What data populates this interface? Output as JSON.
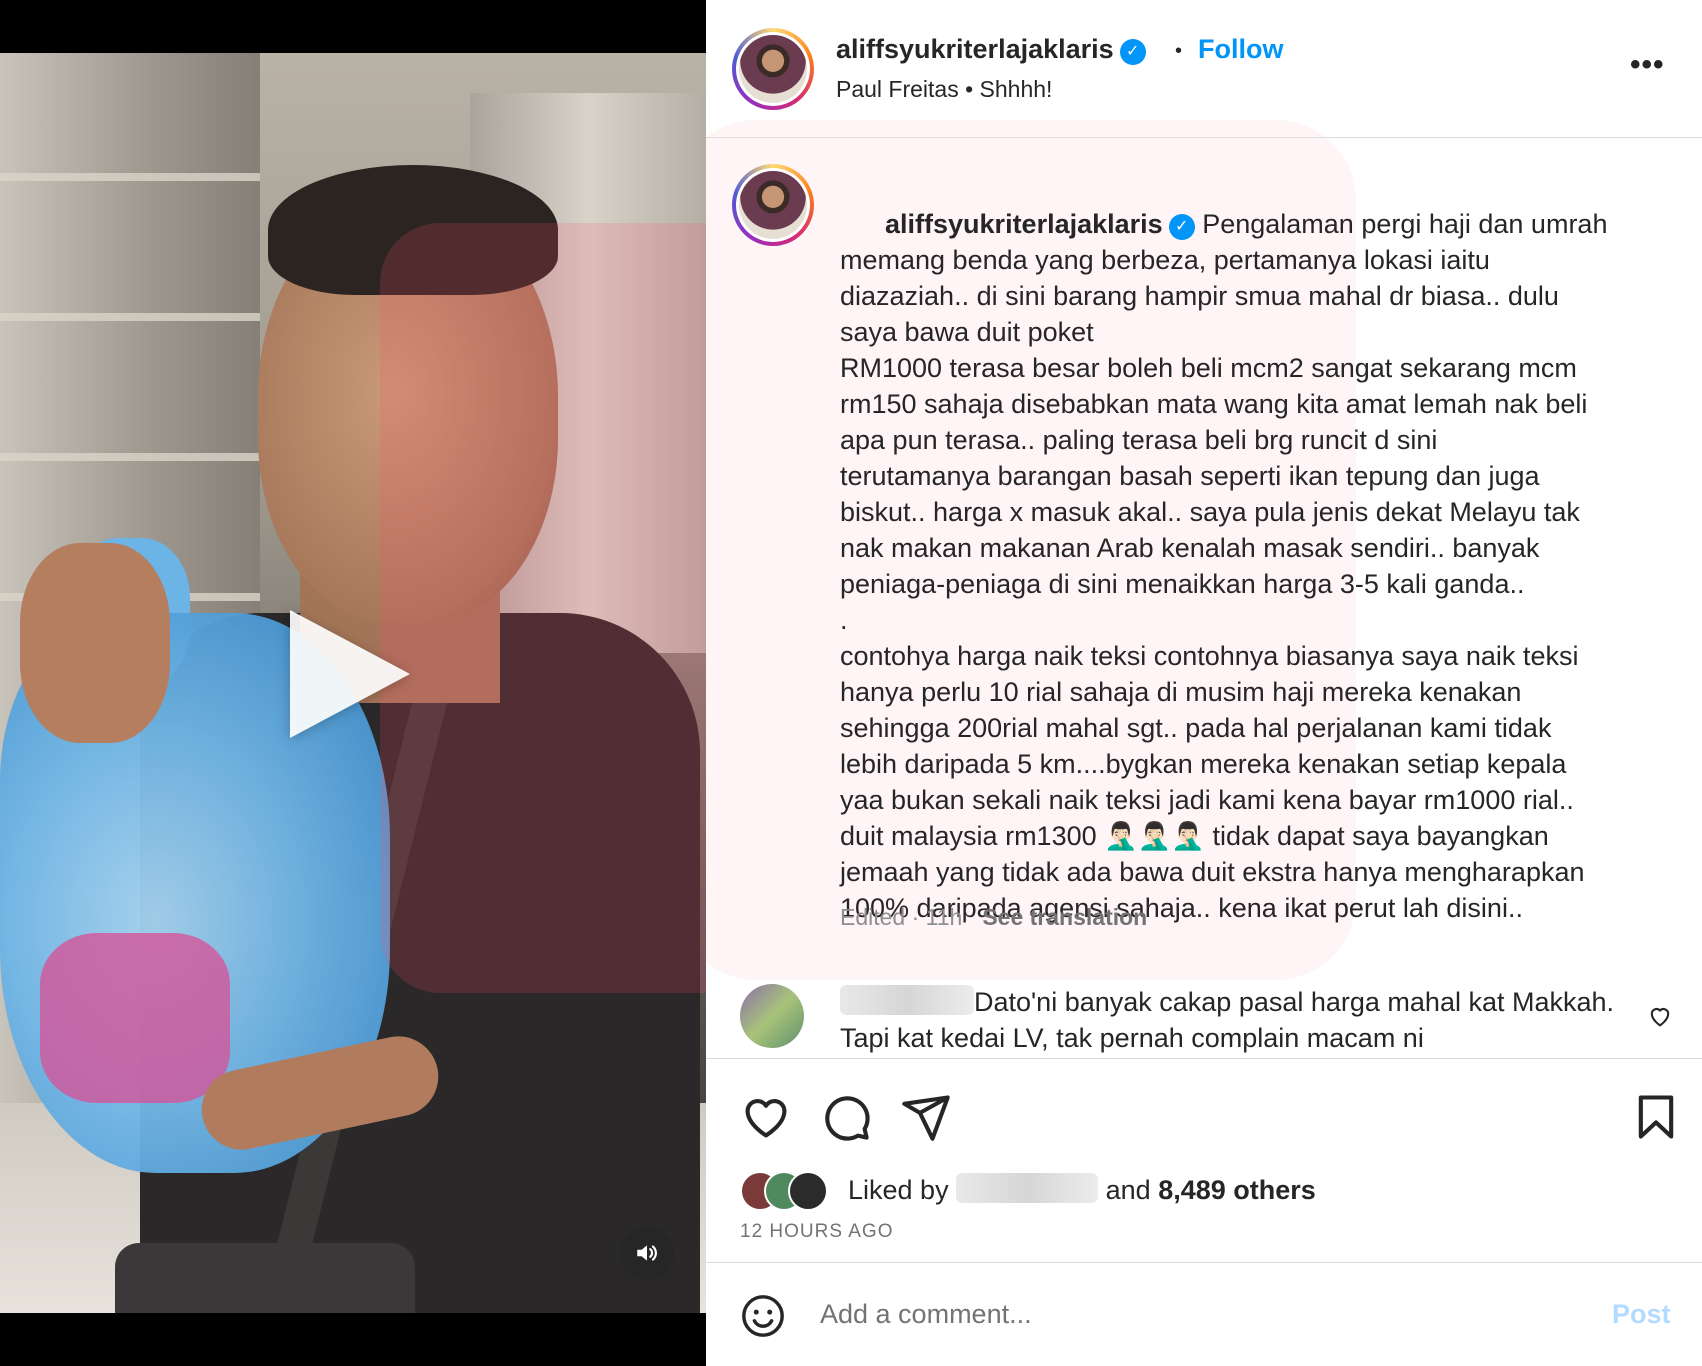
{
  "post": {
    "username": "aliffsyukriterlajaklaris",
    "follow_label": "Follow",
    "separator": "•",
    "audio": "Paul Freitas • Shhhh!",
    "more_label": "•••",
    "caption_lines": [
      "Pengalaman pergi haji dan umrah",
      "memang benda yang berbeza, pertamanya lokasi iaitu",
      "diazaziah.. di sini barang hampir smua mahal dr biasa.. dulu",
      "saya bawa duit poket",
      "RM1000 terasa besar boleh beli mcm2 sangat sekarang mcm",
      "rm150 sahaja disebabkan mata wang kita amat lemah nak beli",
      "apa pun terasa.. paling terasa beli brg runcit d sini",
      "terutamanya barangan basah seperti ikan tepung dan juga",
      "biskut.. harga x masuk akal.. saya pula jenis dekat Melayu tak",
      "nak makan makanan Arab kenalah masak sendiri.. banyak",
      "peniaga-peniaga di sini menaikkan harga 3-5 kali ganda..",
      ".",
      "contohya harga naik teksi contohnya biasanya saya naik teksi",
      "hanya perlu 10 rial sahaja di musim haji mereka kenakan",
      "sehingga 200rial mahal sgt.. pada hal perjalanan kami tidak",
      "lebih daripada 5 km....bygkan mereka kenakan setiap kepala",
      "yaa bukan sekali naik teksi jadi kami kena bayar rm1000 rial..",
      "duit malaysia rm1300 🤦🏻‍♂️🤦🏻‍♂️🤦🏻‍♂️ tidak dapat saya bayangkan",
      "jemaah yang tidak ada bawa duit ekstra hanya mengharapkan",
      "100% daripada agensi sahaja.. kena ikat perut lah disini.."
    ],
    "edited_meta": "Edited · 11h",
    "see_translation": "See translation"
  },
  "comment": {
    "text": "Dato'ni banyak cakap pasal harga mahal kat Makkah. Tapi kat kedai LV, tak pernah complain macam ni"
  },
  "engagement": {
    "liked_by": "Liked by",
    "and": "and",
    "others": "8,489 others",
    "timestamp": "12 HOURS AGO"
  },
  "add_comment": {
    "placeholder": "Add a comment...",
    "post_label": "Post"
  },
  "colors": {
    "link_blue": "#0095f6",
    "post_disabled": "#b3dbff",
    "muted_text": "#737373",
    "border": "#dbdbdb"
  },
  "icons": [
    "play-icon",
    "volume-icon",
    "verified-icon",
    "more-icon",
    "heart-icon",
    "comment-icon",
    "share-icon",
    "bookmark-icon",
    "emoji-icon"
  ]
}
